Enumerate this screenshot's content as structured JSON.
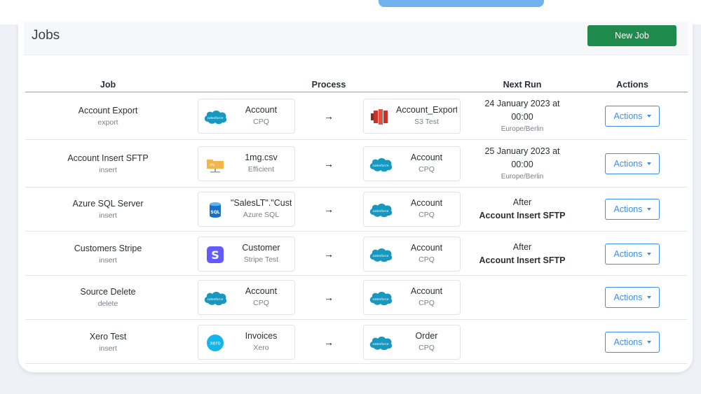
{
  "page": {
    "title": "Jobs",
    "new_job_label": "New Job"
  },
  "table": {
    "headers": {
      "job": "Job",
      "process": "Process",
      "next_run": "Next Run",
      "actions": "Actions"
    },
    "rows": [
      {
        "name": "Account Export",
        "type": "export",
        "source": {
          "title": "Account",
          "subtitle": "CPQ",
          "icon": "salesforce-icon"
        },
        "target": {
          "title": "Account_Export.c",
          "subtitle": "S3 Test",
          "icon": "aws-s3-icon"
        },
        "next_run": {
          "line1": "24 January 2023 at",
          "line2": "00:00",
          "timezone": "Europe/Berlin"
        },
        "actions_label": "Actions"
      },
      {
        "name": "Account Insert SFTP",
        "type": "insert",
        "source": {
          "title": "1mg.csv",
          "subtitle": "Efficient",
          "icon": "sftp-folder-icon"
        },
        "target": {
          "title": "Account",
          "subtitle": "CPQ",
          "icon": "salesforce-icon"
        },
        "next_run": {
          "line1": "25 January 2023 at",
          "line2": "00:00",
          "timezone": "Europe/Berlin"
        },
        "actions_label": "Actions"
      },
      {
        "name": "Azure SQL Server",
        "type": "insert",
        "source": {
          "title": "\"SalesLT\".\"Custon",
          "subtitle": "Azure SQL",
          "icon": "azure-sql-icon"
        },
        "target": {
          "title": "Account",
          "subtitle": "CPQ",
          "icon": "salesforce-icon"
        },
        "next_run": {
          "line1": "After",
          "line2": "Account Insert SFTP"
        },
        "actions_label": "Actions"
      },
      {
        "name": "Customers Stripe",
        "type": "insert",
        "source": {
          "title": "Customer",
          "subtitle": "Stripe Test",
          "icon": "stripe-icon"
        },
        "target": {
          "title": "Account",
          "subtitle": "CPQ",
          "icon": "salesforce-icon"
        },
        "next_run": {
          "line1": "After",
          "line2": "Account Insert SFTP"
        },
        "actions_label": "Actions"
      },
      {
        "name": "Source Delete",
        "type": "delete",
        "source": {
          "title": "Account",
          "subtitle": "CPQ",
          "icon": "salesforce-icon"
        },
        "target": {
          "title": "Account",
          "subtitle": "CPQ",
          "icon": "salesforce-icon"
        },
        "next_run": {},
        "actions_label": "Actions"
      },
      {
        "name": "Xero Test",
        "type": "insert",
        "source": {
          "title": "Invoices",
          "subtitle": "Xero",
          "icon": "xero-icon"
        },
        "target": {
          "title": "Order",
          "subtitle": "CPQ",
          "icon": "salesforce-icon"
        },
        "next_run": {},
        "actions_label": "Actions"
      }
    ]
  },
  "colors": {
    "primary_green": "#1e8a4c",
    "action_blue": "#3c8ee6",
    "salesforce_blue": "#1798c1",
    "stripe_purple": "#635bff",
    "xero_blue": "#13b5ea"
  }
}
